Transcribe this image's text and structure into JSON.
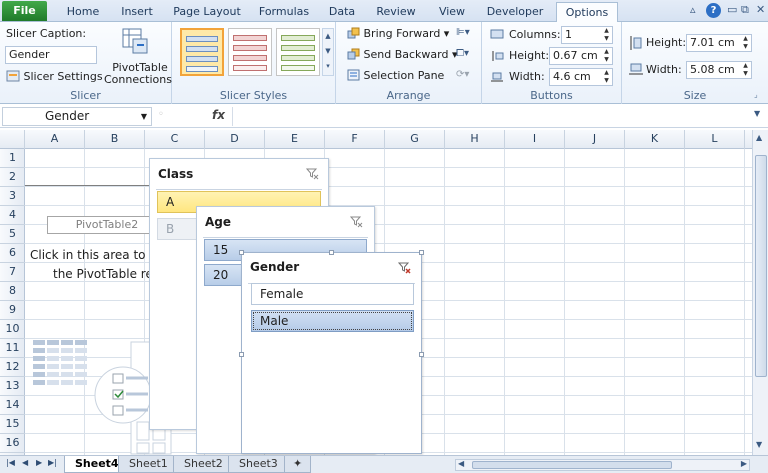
{
  "ribbon_tabs": [
    {
      "label": "File"
    },
    {
      "label": "Home"
    },
    {
      "label": "Insert"
    },
    {
      "label": "Page Layout"
    },
    {
      "label": "Formulas"
    },
    {
      "label": "Data"
    },
    {
      "label": "Review"
    },
    {
      "label": "View"
    },
    {
      "label": "Developer"
    },
    {
      "label": "Options"
    }
  ],
  "active_tab": "Options",
  "colors": {
    "file_tab": "#2e8b3a",
    "accent": "#f2a33a",
    "slicer_yellow": "#ffe680",
    "slicer_blue": "#b8cde8"
  },
  "slicer_group": {
    "caption_label": "Slicer Caption:",
    "caption_value": "Gender",
    "settings_label": "Slicer Settings",
    "connections_label_1": "PivotTable",
    "connections_label_2": "Connections",
    "group_label": "Slicer"
  },
  "styles_group": {
    "group_label": "Slicer Styles"
  },
  "arrange_group": {
    "bring_forward": "Bring Forward",
    "send_backward": "Send Backward",
    "selection_pane": "Selection Pane",
    "group_label": "Arrange"
  },
  "buttons_group": {
    "columns_label": "Columns:",
    "columns_value": "1",
    "height_label": "Height:",
    "height_value": "0.67 cm",
    "width_label": "Width:",
    "width_value": "4.6 cm",
    "group_label": "Buttons"
  },
  "size_group": {
    "height_label": "Height:",
    "height_value": "7.01 cm",
    "width_label": "Width:",
    "width_value": "5.08 cm",
    "group_label": "Size"
  },
  "formula_bar": {
    "name_box": "Gender",
    "fx": "fx",
    "formula": ""
  },
  "columns": [
    "A",
    "B",
    "C",
    "D",
    "E",
    "F",
    "G",
    "H",
    "I",
    "J",
    "K",
    "L"
  ],
  "rows": [
    "1",
    "2",
    "3",
    "4",
    "5",
    "6",
    "7",
    "8",
    "9",
    "10",
    "11",
    "12",
    "13",
    "14",
    "15",
    "16"
  ],
  "pivot": {
    "placeholder": "PivotTable2",
    "note_line1": "Click in this area to w",
    "note_line2": "the PivotTable re"
  },
  "slicers": {
    "class": {
      "title": "Class",
      "items": [
        "A",
        "B"
      ]
    },
    "age": {
      "title": "Age",
      "items": [
        "15",
        "20"
      ]
    },
    "gender": {
      "title": "Gender",
      "items": [
        "Female",
        "Male"
      ],
      "selected": "Male"
    }
  },
  "sheets": [
    {
      "name": "Sheet4",
      "active": true
    },
    {
      "name": "Sheet1",
      "active": false
    },
    {
      "name": "Sheet2",
      "active": false
    },
    {
      "name": "Sheet3",
      "active": false
    }
  ]
}
